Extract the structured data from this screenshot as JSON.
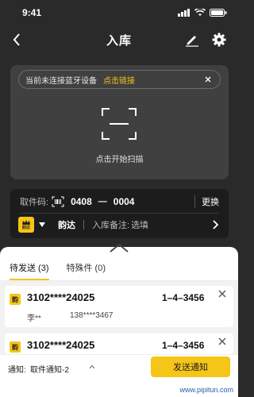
{
  "status": {
    "time": "9:41"
  },
  "nav": {
    "title": "入库"
  },
  "bluetooth": {
    "message": "当前未连接蓝牙设备",
    "link": "点击链接"
  },
  "scan": {
    "label": "点击开始扫描"
  },
  "pickup": {
    "label": "取件码:",
    "code_a": "0408",
    "dash": "—",
    "code_b": "0004",
    "change": "更换",
    "courier_logo": "韵达",
    "courier_name": "韵达",
    "note_label": "入库备注:",
    "note_value": "选填"
  },
  "tabs": [
    {
      "label": "待发送 (3)",
      "active": true
    },
    {
      "label": "特殊件 (0)",
      "active": false
    }
  ],
  "items": [
    {
      "badge": "韵",
      "tracking": "3102****24025",
      "code": "1–4–3456",
      "receiver": "李**",
      "phone": "138****3467"
    },
    {
      "badge": "韵",
      "tracking": "3102****24025",
      "code": "1–4–3456"
    }
  ],
  "footer": {
    "notice_label": "通知:",
    "notice_value": "取件通知-2",
    "send_label": "发送通知"
  },
  "watermark": "www.pipitun.com",
  "colors": {
    "accent": "#f5c518",
    "dark_bg": "#2a2a2a",
    "card_bg": "#404040"
  }
}
